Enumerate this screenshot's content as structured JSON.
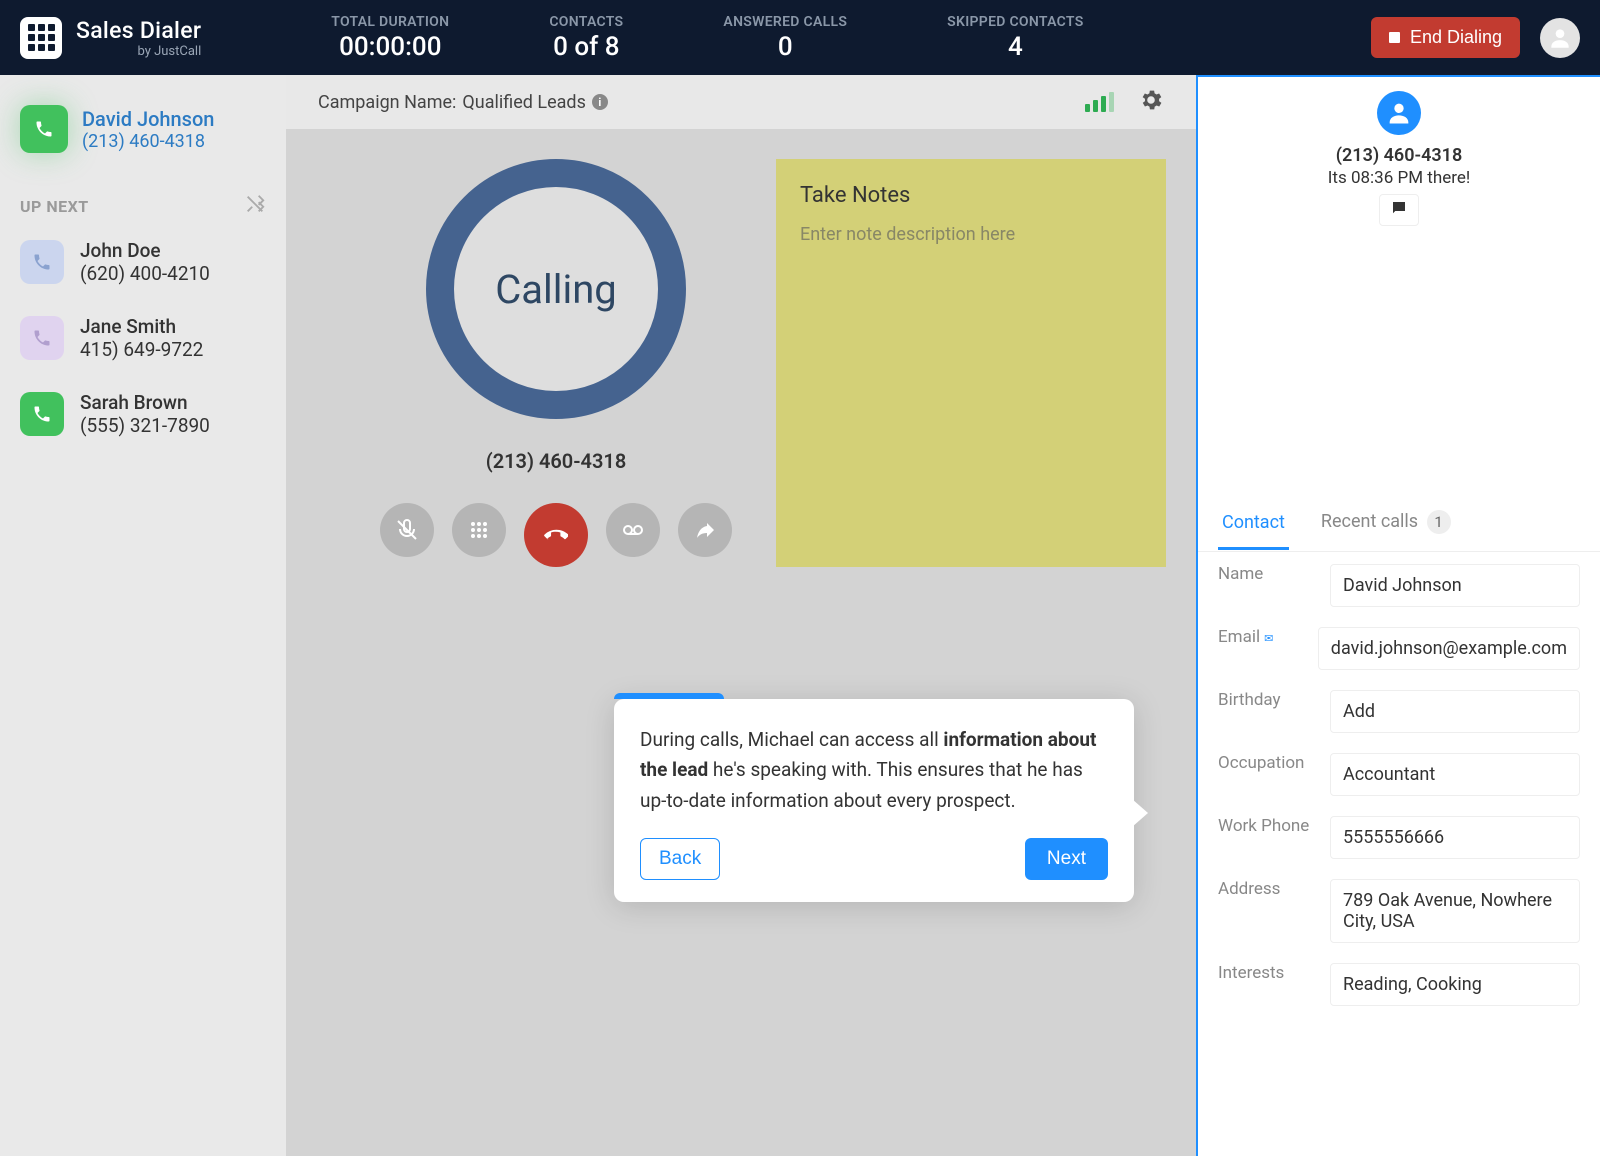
{
  "logo": {
    "title": "Sales Dialer",
    "subtitle": "by JustCall"
  },
  "stats": {
    "duration": {
      "label": "TOTAL DURATION",
      "value": "00:00:00"
    },
    "contacts": {
      "label": "CONTACTS",
      "value": "0 of 8"
    },
    "answered": {
      "label": "ANSWERED CALLS",
      "value": "0"
    },
    "skipped": {
      "label": "SKIPPED CONTACTS",
      "value": "4"
    }
  },
  "header": {
    "end_dialing": "End Dialing"
  },
  "sidebar": {
    "active": {
      "name": "David Johnson",
      "phone": "(213) 460-4318"
    },
    "upnext_label": "UP NEXT",
    "items": [
      {
        "name": "John Doe",
        "phone": "(620) 400-4210",
        "badge": "blue"
      },
      {
        "name": "Jane Smith",
        "phone": "415) 649-9722",
        "badge": "purple"
      },
      {
        "name": "Sarah Brown",
        "phone": "(555) 321-7890",
        "badge": "green"
      }
    ]
  },
  "campaign": {
    "prefix": "Campaign Name: ",
    "name": "Qualified Leads"
  },
  "call": {
    "status": "Calling",
    "phone": "(213) 460-4318"
  },
  "notes": {
    "title": "Take Notes",
    "placeholder": "Enter note description here"
  },
  "popover": {
    "text_before": "During calls, Michael can access all ",
    "bold": "information about the lead",
    "text_after": " he's speaking with. This ensures that he has up-to-date information about every prospect.",
    "back": "Back",
    "next": "Next"
  },
  "panel": {
    "phone": "(213) 460-4318",
    "time": "Its 08:36 PM there!",
    "tabs": {
      "contact": "Contact",
      "recent": "Recent calls",
      "recent_count": "1"
    },
    "fields": {
      "name": {
        "label": "Name",
        "value": "David Johnson"
      },
      "email": {
        "label": "Email",
        "value": "david.johnson@example.com"
      },
      "birthday": {
        "label": "Birthday",
        "value": "Add"
      },
      "occupation": {
        "label": "Occupation",
        "value": "Accountant"
      },
      "workphone": {
        "label": "Work Phone",
        "value": "5555556666"
      },
      "address": {
        "label": "Address",
        "value": "789 Oak Avenue, Nowhere City, USA"
      },
      "interests": {
        "label": "Interests",
        "value": "Reading, Cooking"
      }
    }
  }
}
